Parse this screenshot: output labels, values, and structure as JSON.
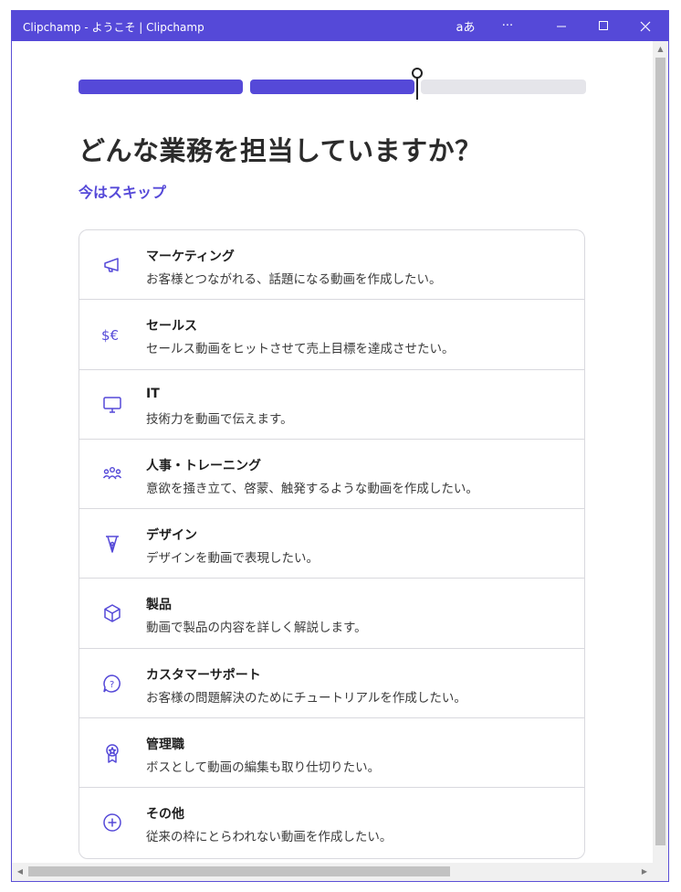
{
  "window": {
    "title": "Clipchamp - ようこそ | Clipchamp",
    "font_button_label": "aあ",
    "more_label": "···",
    "minimize_label": "—",
    "close_label": "✕"
  },
  "progress": {
    "steps_total": 3,
    "steps_complete": 2
  },
  "page": {
    "heading": "どんな業務を担当していますか？",
    "skip_label": "今はスキップ"
  },
  "roles": [
    {
      "icon": "megaphone-icon",
      "title": "マーケティング",
      "desc": "お客様とつながれる、話題になる動画を作成したい。"
    },
    {
      "icon": "currency-icon",
      "title": "セールス",
      "desc": "セールス動画をヒットさせて売上目標を達成させたい。"
    },
    {
      "icon": "monitor-icon",
      "title": "IT",
      "desc": "技術力を動画で伝えます。"
    },
    {
      "icon": "people-icon",
      "title": "人事・トレーニング",
      "desc": "意欲を掻き立て、啓蒙、触発するような動画を作成したい。"
    },
    {
      "icon": "pen-nib-icon",
      "title": "デザイン",
      "desc": "デザインを動画で表現したい。"
    },
    {
      "icon": "box-icon",
      "title": "製品",
      "desc": "動画で製品の内容を詳しく解説します。"
    },
    {
      "icon": "help-bubble-icon",
      "title": "カスタマーサポート",
      "desc": "お客様の問題解決のためにチュートリアルを作成したい。"
    },
    {
      "icon": "award-ribbon-icon",
      "title": "管理職",
      "desc": "ボスとして動画の編集も取り仕切りたい。"
    },
    {
      "icon": "plus-circle-icon",
      "title": "その他",
      "desc": "従来の枠にとらわれない動画を作成したい。"
    }
  ],
  "colors": {
    "accent": "#5549d8",
    "titlebar": "#5549d8",
    "border": "#d9d9de"
  }
}
